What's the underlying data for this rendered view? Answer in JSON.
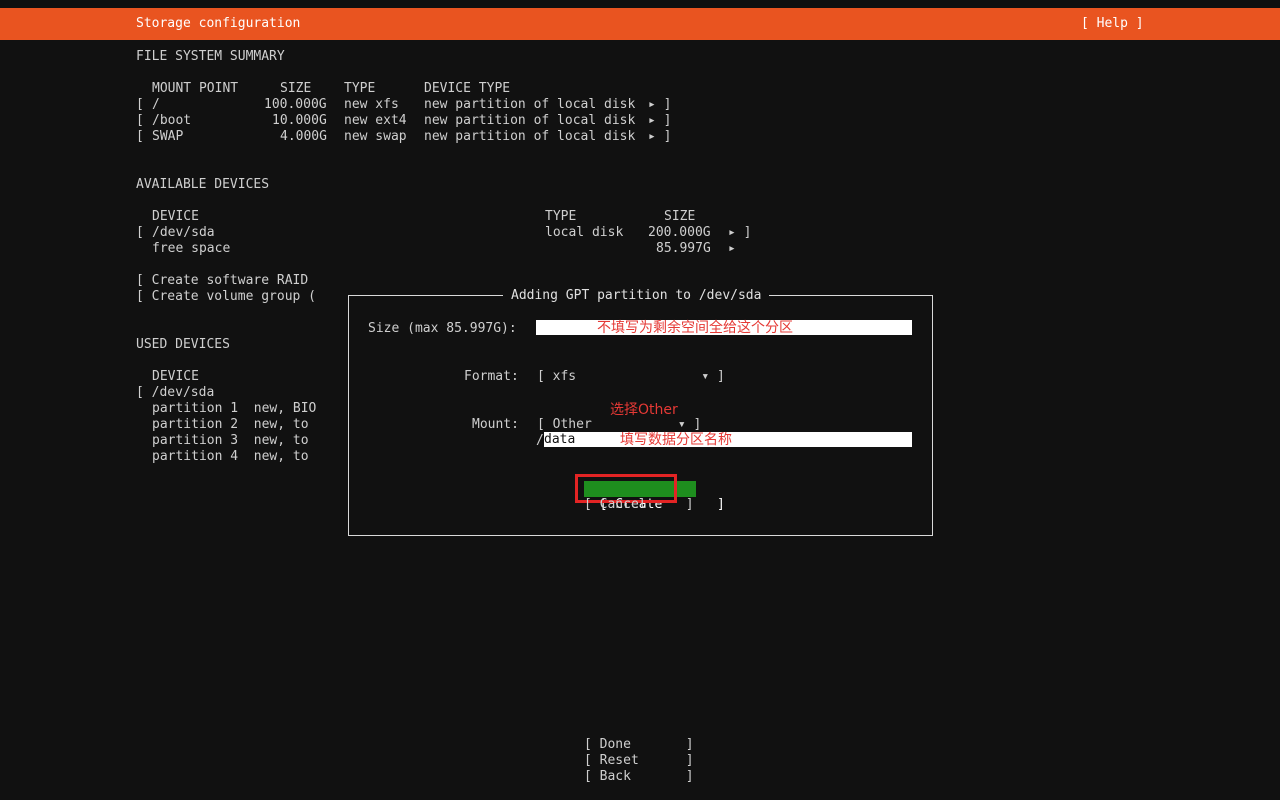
{
  "header": {
    "title": "Storage configuration",
    "help": "[ Help ]"
  },
  "fs_summary": {
    "heading": "FILE SYSTEM SUMMARY",
    "columns": {
      "mount": "MOUNT POINT",
      "size": "SIZE",
      "type": "TYPE",
      "device_type": "DEVICE TYPE"
    },
    "rows": [
      {
        "bracket": "[",
        "mount": "/",
        "size": "100.000G",
        "type": "new xfs",
        "device_type": "new partition of local disk",
        "arrow": "▸ ]"
      },
      {
        "bracket": "[",
        "mount": "/boot",
        "size": "10.000G",
        "type": "new ext4",
        "device_type": "new partition of local disk",
        "arrow": "▸ ]"
      },
      {
        "bracket": "[",
        "mount": "SWAP",
        "size": "4.000G",
        "type": "new swap",
        "device_type": "new partition of local disk",
        "arrow": "▸ ]"
      }
    ]
  },
  "available": {
    "heading": "AVAILABLE DEVICES",
    "columns": {
      "device": "DEVICE",
      "type": "TYPE",
      "size": "SIZE"
    },
    "sda": {
      "bracket": "[",
      "name": "/dev/sda",
      "type": "local disk",
      "size": "200.000G",
      "arrow": "▸ ]"
    },
    "free": {
      "name": "free space",
      "size": "85.997G",
      "arrow": "▸"
    },
    "create_raid": "[ Create software RAID",
    "create_vg": "[ Create volume group ("
  },
  "used": {
    "heading": "USED DEVICES",
    "column": "DEVICE",
    "sda": "[ /dev/sda",
    "partitions": [
      "partition 1  new, BIO",
      "partition 2  new, to",
      "partition 3  new, to",
      "partition 4  new, to"
    ]
  },
  "dialog": {
    "title": "Adding GPT partition to /dev/sda",
    "size_label": "Size (max 85.997G):",
    "size_value": "",
    "format_label": "Format:",
    "format_value": "[ xfs                ▾ ]",
    "mount_label": "Mount:",
    "mount_select": "[ Other           ▾ ]",
    "mount_prefix": "/",
    "mount_value": "data",
    "create": "[ Create       ]",
    "cancel": "[ Cancel     ]"
  },
  "annotations": {
    "size_hint": "不填写为剩余空间全给这个分区",
    "other_hint": "选择Other",
    "data_hint": "填写数据分区名称"
  },
  "footer": {
    "done": "[ Done       ]",
    "reset": "[ Reset      ]",
    "back": "[ Back       ]"
  },
  "colors": {
    "accent": "#e95420",
    "selected": "#1e8e1e",
    "annotation": "#e53935"
  }
}
